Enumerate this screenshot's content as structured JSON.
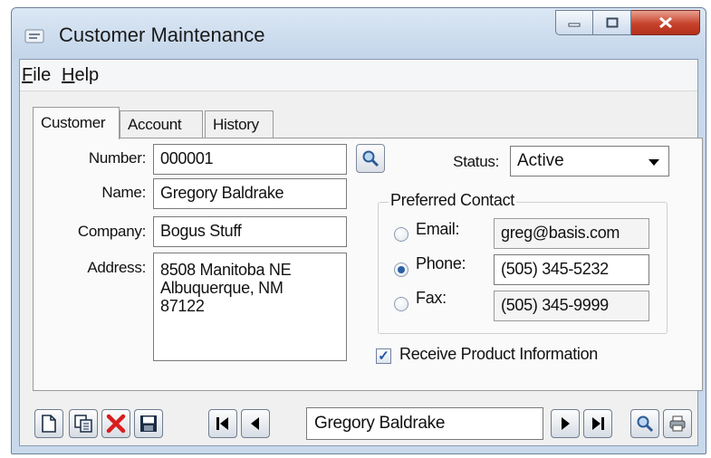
{
  "window": {
    "title": "Customer Maintenance"
  },
  "menu": [
    {
      "label": "File",
      "mnemonic": "F",
      "rest": "ile"
    },
    {
      "label": "Help",
      "mnemonic": "H",
      "rest": "elp"
    }
  ],
  "tabs": [
    "Customer",
    "Account",
    "History"
  ],
  "form": {
    "number_label": "Number:",
    "number": "000001",
    "name_label": "Name:",
    "name": "Gregory Baldrake",
    "company_label": "Company:",
    "company": "Bogus Stuff",
    "address_label": "Address:",
    "address": "8508 Manitoba NE\nAlbuquerque, NM\n87122",
    "status_label": "Status:",
    "status": "Active"
  },
  "preferred_contact": {
    "title": "Preferred Contact",
    "options": [
      {
        "label": "Email:",
        "value": "greg@basis.com",
        "selected": false,
        "editable": false
      },
      {
        "label": "Phone:",
        "value": "(505) 345-5232",
        "selected": true,
        "editable": true
      },
      {
        "label": "Fax:",
        "value": "(505) 345-9999",
        "selected": false,
        "editable": false
      }
    ]
  },
  "receive_info": {
    "label": "Receive Product Information",
    "checked": true
  },
  "navigator": {
    "current": "Gregory Baldrake"
  },
  "icons": {
    "toolbar": [
      "new-record-icon",
      "copy-record-icon",
      "delete-icon",
      "save-icon"
    ],
    "nav": [
      "first-record-icon",
      "previous-record-icon",
      "next-record-icon",
      "last-record-icon"
    ],
    "right": [
      "search-icon",
      "print-icon"
    ]
  },
  "colors": {
    "delete": "#d81e1e",
    "accent": "#2a5fa8"
  }
}
